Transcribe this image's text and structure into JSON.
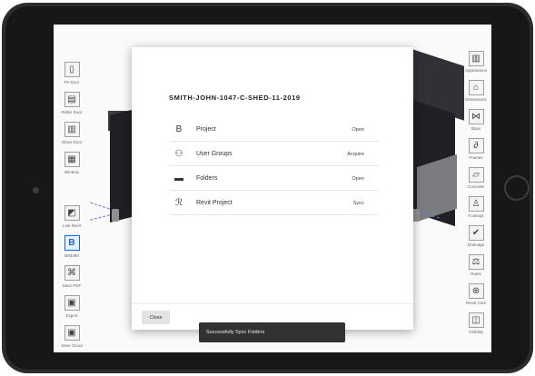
{
  "left_toolbar": {
    "top": [
      {
        "label": "PA Door",
        "icon": "door-icon",
        "glyph": "▯"
      },
      {
        "label": "Roller Door",
        "icon": "roller-door-icon",
        "glyph": "▤"
      },
      {
        "label": "Glass Door",
        "icon": "glass-door-icon",
        "glyph": "▥"
      },
      {
        "label": "Window",
        "icon": "window-icon",
        "glyph": "▦"
      }
    ],
    "bottom": [
      {
        "label": "Link Revit",
        "icon": "link-revit-icon",
        "glyph": "◩"
      },
      {
        "label": "BIM360",
        "icon": "bim360-icon",
        "glyph": "B",
        "active": true
      },
      {
        "label": "Save PDF",
        "icon": "pdf-icon",
        "glyph": "⌘"
      },
      {
        "label": "Export",
        "icon": "save-icon",
        "glyph": "▣"
      },
      {
        "label": "Save Cloud",
        "icon": "save-cloud-icon",
        "glyph": "▣"
      }
    ]
  },
  "right_toolbar": [
    {
      "label": "Appearance",
      "icon": "appearance-icon",
      "glyph": "▥"
    },
    {
      "label": "Dimensions",
      "icon": "dimensions-icon",
      "glyph": "⌂"
    },
    {
      "label": "Bays",
      "icon": "bays-icon",
      "glyph": "⋈"
    },
    {
      "label": "Frames",
      "icon": "frames-icon",
      "glyph": "∂"
    },
    {
      "label": "Concrete",
      "icon": "concrete-icon",
      "glyph": "▱"
    },
    {
      "label": "Footings",
      "icon": "footings-icon",
      "glyph": "♙"
    },
    {
      "label": "Drainage",
      "icon": "drainage-icon",
      "glyph": "✔"
    },
    {
      "label": "Rules",
      "icon": "rules-icon",
      "glyph": "⚖"
    },
    {
      "label": "Reset Cam",
      "icon": "reset-camera-icon",
      "glyph": "⊕"
    },
    {
      "label": "Visibility",
      "icon": "visibility-icon",
      "glyph": "◫"
    }
  ],
  "modal": {
    "title": "SMITH-JOHN-1047-C-SHED-11-2019",
    "rows": [
      {
        "label": "Project",
        "action": "Open",
        "icon": "bim-b-icon",
        "glyph": "B"
      },
      {
        "label": "User Groups",
        "action": "Acquire",
        "icon": "user-groups-icon",
        "glyph": "⚇"
      },
      {
        "label": "Folders",
        "action": "Open",
        "icon": "folder-icon",
        "glyph": "▬"
      },
      {
        "label": "Revit Project",
        "action": "Sync",
        "icon": "revit-icon",
        "glyph": "ℛ"
      }
    ],
    "close_label": "Close"
  },
  "snackbar": {
    "message": "Successfully Sync Folders"
  }
}
